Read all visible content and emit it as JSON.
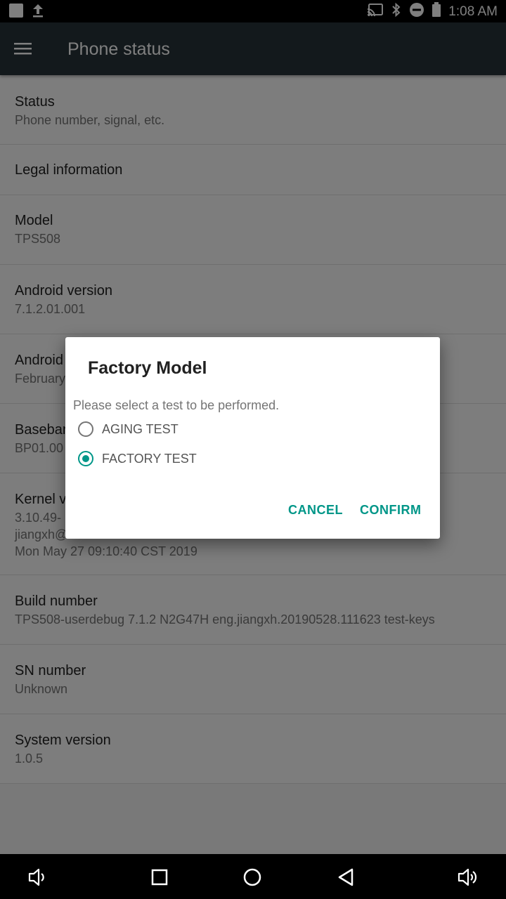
{
  "status_bar": {
    "time": "1:08 AM",
    "left_icons": [
      "notification-square-icon",
      "upload-icon"
    ],
    "right_icons": [
      "cast-icon",
      "bluetooth-icon",
      "do-not-disturb-icon",
      "battery-icon"
    ]
  },
  "app_bar": {
    "menu_icon": "hamburger-menu-icon",
    "title": "Phone status"
  },
  "list": [
    {
      "title": "Status",
      "subtitle": "Phone number, signal, etc."
    },
    {
      "title": "Legal information"
    },
    {
      "title": "Model",
      "subtitle": "TPS508"
    },
    {
      "title": "Android version",
      "subtitle": "7.1.2.01.001"
    },
    {
      "title": "Android",
      "subtitle": "February"
    },
    {
      "title": "Baseband",
      "subtitle": "BP01.00"
    },
    {
      "title": "Kernel v",
      "subtitle_lines": [
        "3.10.49-",
        "jiangxh@",
        "Mon May 27 09:10:40 CST 2019"
      ]
    },
    {
      "title": "Build number",
      "subtitle": "TPS508-userdebug 7.1.2 N2G47H eng.jiangxh.20190528.111623 test-keys"
    },
    {
      "title": "SN number",
      "subtitle": "Unknown"
    },
    {
      "title": "System version",
      "subtitle": "1.0.5"
    }
  ],
  "dialog": {
    "title": "Factory Model",
    "message": "Please select a test to be performed.",
    "options": [
      {
        "label": "AGING TEST",
        "selected": false
      },
      {
        "label": "FACTORY TEST",
        "selected": true
      }
    ],
    "cancel_label": "CANCEL",
    "confirm_label": "CONFIRM",
    "accent_color": "#009688"
  },
  "nav_bar": {
    "icons": [
      "volume-down-icon",
      "recents-icon",
      "home-icon",
      "back-icon",
      "volume-up-icon"
    ]
  }
}
